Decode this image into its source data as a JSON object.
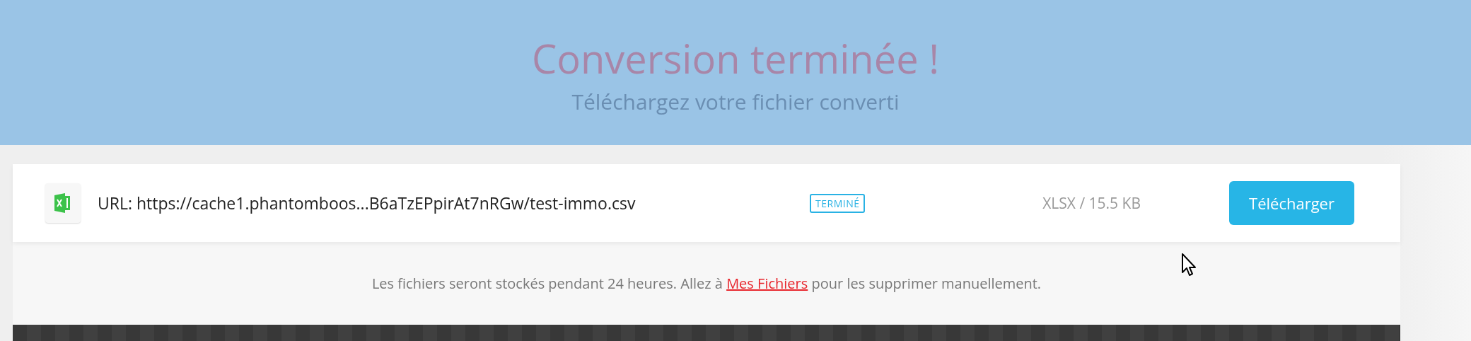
{
  "header": {
    "title": "Conversion terminée !",
    "subtitle": "Téléchargez votre fichier converti"
  },
  "files": [
    {
      "kind": "excel",
      "url": "URL: https://cache1.phantomboos...B6aTzEPpirAt7nRGw/test-immo.csv",
      "status": "TERMINÉ",
      "size": "XLSX / 15.5 KB",
      "action": "Télécharger"
    }
  ],
  "notice": {
    "before": "Les fichiers seront stockés pendant 24 heures. Allez à",
    "link": "Mes Fichiers",
    "after": "pour les supprimer manuellement."
  }
}
